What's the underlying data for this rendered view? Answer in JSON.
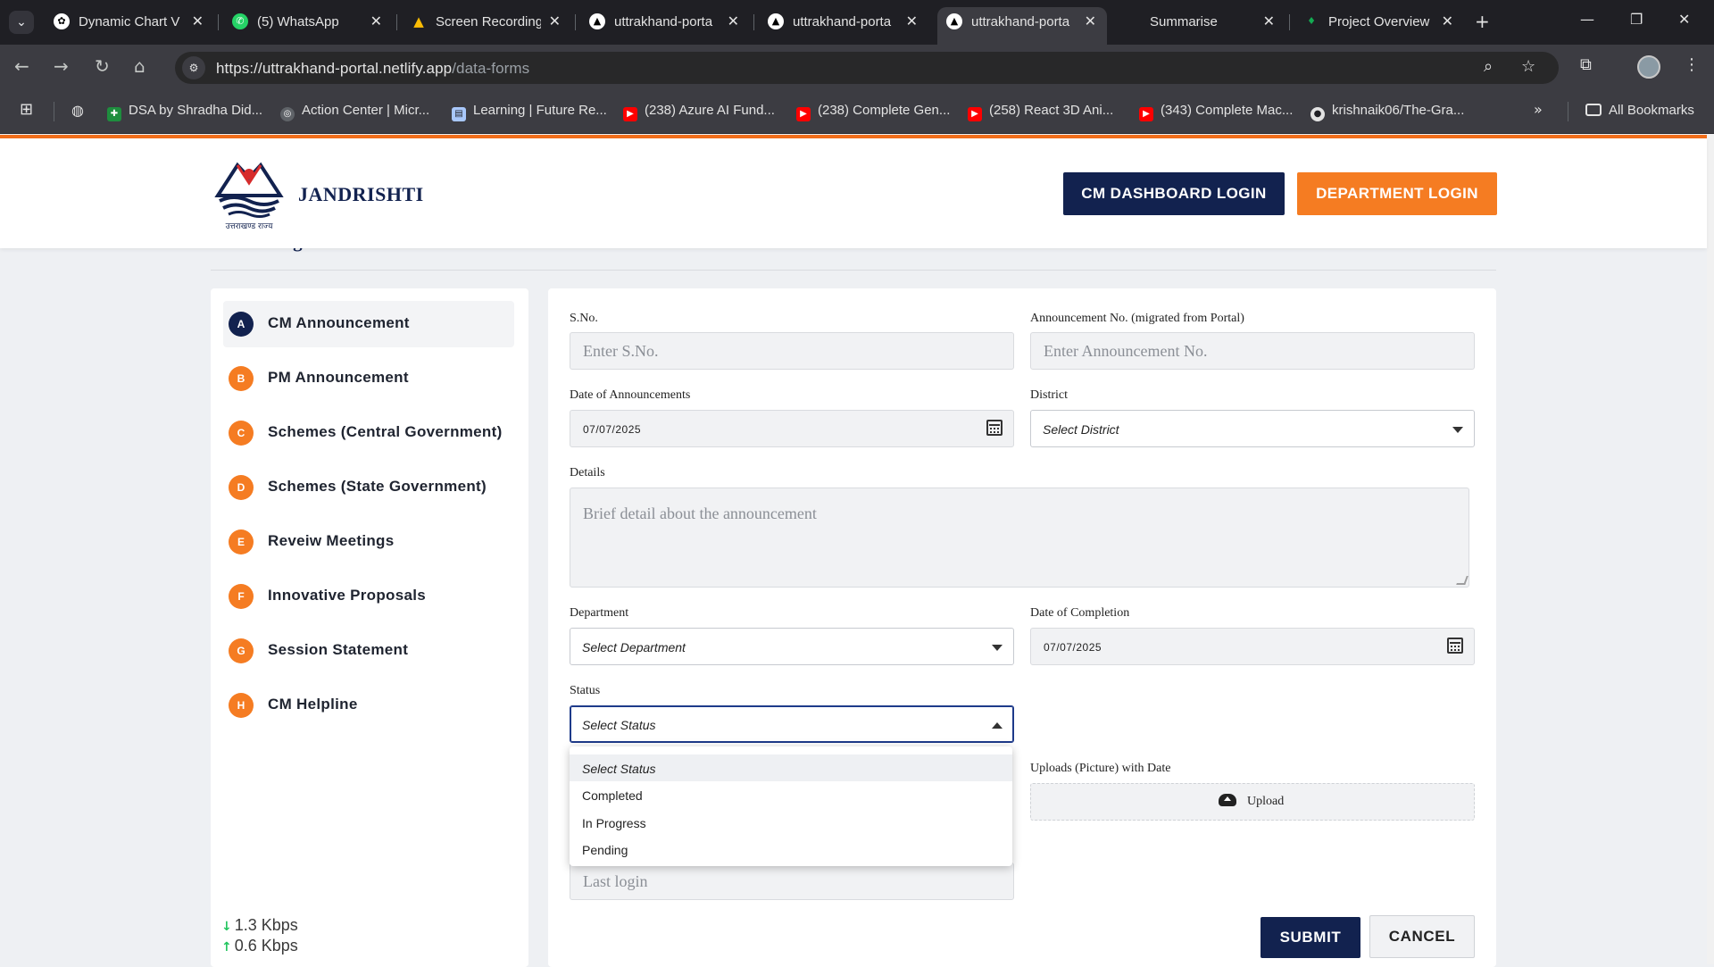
{
  "browser": {
    "tabs": [
      {
        "title": "Dynamic Chart V",
        "icon": "chatgpt-icon",
        "active": false
      },
      {
        "title": "(5) WhatsApp",
        "icon": "whatsapp-icon",
        "active": false
      },
      {
        "title": "Screen Recording",
        "icon": "google-drive-icon",
        "active": false
      },
      {
        "title": "uttrakhand-porta",
        "icon": "netlify-icon",
        "active": false
      },
      {
        "title": "uttrakhand-porta",
        "icon": "netlify-icon",
        "active": false
      },
      {
        "title": "uttrakhand-porta",
        "icon": "netlify-icon",
        "active": true
      },
      {
        "title": "Summarise",
        "icon": "blank-icon",
        "active": false
      },
      {
        "title": "Project Overview",
        "icon": "mongodb-icon",
        "active": false
      }
    ],
    "url_host": "https://uttrakhand-portal.netlify.app",
    "url_path": "/data-forms",
    "bookmarks": [
      {
        "label": "DSA by Shradha Did...",
        "icon": "sheets-icon",
        "color": "#1e8e3e"
      },
      {
        "label": "Action Center | Micr...",
        "icon": "globe-icon",
        "color": "#5f6368"
      },
      {
        "label": "Learning | Future Re...",
        "icon": "doc-icon",
        "color": "#a8c7fa"
      },
      {
        "label": "(238) Azure AI Fund...",
        "icon": "youtube-icon",
        "color": "#ff0000"
      },
      {
        "label": "(238) Complete Gen...",
        "icon": "youtube-icon",
        "color": "#ff0000"
      },
      {
        "label": "(258) React 3D Ani...",
        "icon": "youtube-icon",
        "color": "#ff0000"
      },
      {
        "label": "(343) Complete Mac...",
        "icon": "youtube-icon",
        "color": "#ff0000"
      },
      {
        "label": "krishnaik06/The-Gra...",
        "icon": "github-icon",
        "color": "#333333"
      }
    ],
    "all_bookmarks": "All Bookmarks"
  },
  "header": {
    "logo_caption": "उत्तराखण्ड राज्य",
    "brand": "JANDRISHTI",
    "cm_login": "CM DASHBOARD LOGIN",
    "dept_login": "DEPARTMENT LOGIN",
    "peek_title": "Monitoring Dashboard"
  },
  "sidebar": {
    "items": [
      {
        "badge": "A",
        "label": "CM Announcement",
        "active": true
      },
      {
        "badge": "B",
        "label": "PM Announcement",
        "active": false
      },
      {
        "badge": "C",
        "label": "Schemes (Central Government)",
        "active": false
      },
      {
        "badge": "D",
        "label": "Schemes (State Government)",
        "active": false
      },
      {
        "badge": "E",
        "label": "Reveiw Meetings",
        "active": false
      },
      {
        "badge": "F",
        "label": "Innovative Proposals",
        "active": false
      },
      {
        "badge": "G",
        "label": "Session Statement",
        "active": false
      },
      {
        "badge": "H",
        "label": "CM Helpline",
        "active": false
      }
    ],
    "net_down": "1.3 Kbps",
    "net_up": "0.6 Kbps"
  },
  "form": {
    "sno_label": "S.No.",
    "sno_placeholder": "Enter S.No.",
    "ann_label": "Announcement No. (migrated from Portal)",
    "ann_placeholder": "Enter Announcement No.",
    "date_label": "Date of Announcements",
    "date_value": "07/07/2025",
    "district_label": "District",
    "district_value": "Select District",
    "details_label": "Details",
    "details_placeholder": "Brief detail about the announcement",
    "dept_label": "Department",
    "dept_value": "Select Department",
    "completion_label": "Date of Completion",
    "completion_value": "07/07/2025",
    "status_label": "Status",
    "status_value": "Select Status",
    "status_options": [
      "Select Status",
      "Completed",
      "In Progress",
      "Pending"
    ],
    "upload_label": "Uploads (Picture) with Date",
    "upload_button": "Upload",
    "lastlogin_placeholder": "Last login",
    "submit": "SUBMIT",
    "cancel": "CANCEL"
  }
}
